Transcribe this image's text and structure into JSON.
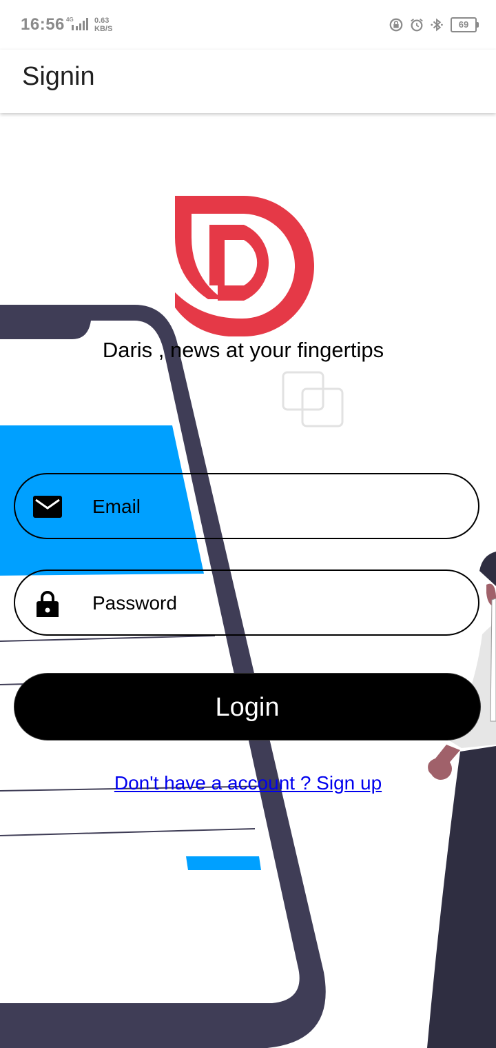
{
  "status_bar": {
    "time": "16:56",
    "network_label": "4G",
    "speed_value": "0.63",
    "speed_unit": "KB/S",
    "battery": "69",
    "icons": [
      "lock-rotation-icon",
      "alarm-icon",
      "bluetooth-icon",
      "battery-icon"
    ]
  },
  "app_bar": {
    "title": "Signin"
  },
  "brand": {
    "logo_color": "#E53947",
    "tagline": "Daris , news at your fingertips"
  },
  "form": {
    "email_placeholder": "Email",
    "password_placeholder": "Password",
    "email_icon": "mail-icon",
    "password_icon": "lock-icon",
    "login_label": "Login",
    "signup_link": "Don't have a account ? Sign up"
  },
  "colors": {
    "accent_red": "#E53947",
    "illustration_blue": "#00A0FF",
    "phone_frame": "#3F3D56",
    "link_blue": "#0000EE",
    "button_bg": "#000000"
  }
}
